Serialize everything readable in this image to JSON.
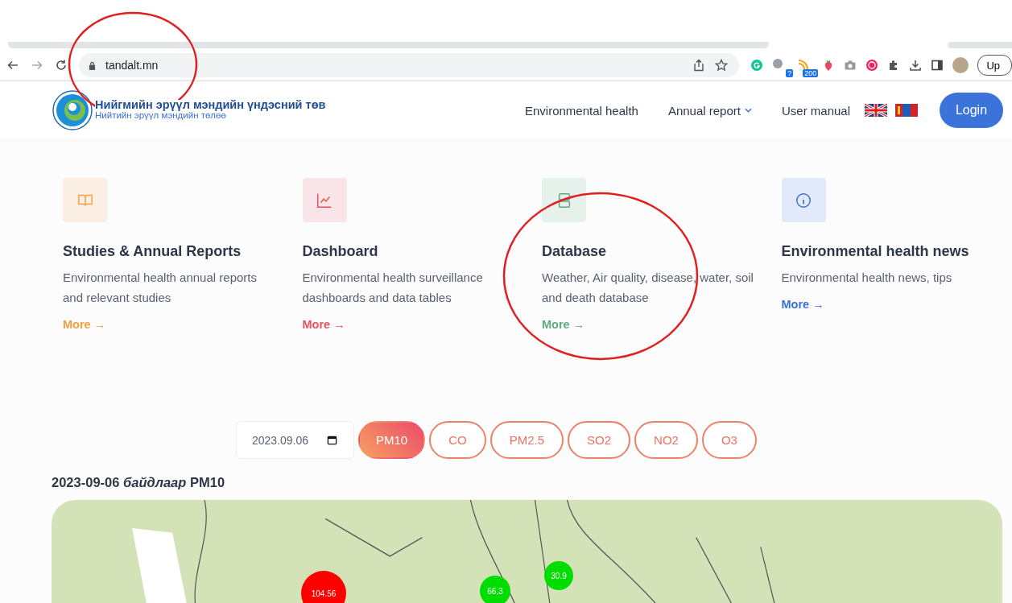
{
  "browser": {
    "url": "tandalt.mn",
    "extension_badges": [
      "?",
      "200"
    ],
    "profile_button": "Up"
  },
  "header": {
    "logo_title": "Нийгмийн эрүүл мэндийн үндэсний төв",
    "logo_subtitle": "Нийтийн эрүүл мэндийн төлөө",
    "nav": [
      {
        "label": "Environmental health",
        "dropdown": false
      },
      {
        "label": "Annual report",
        "dropdown": true
      },
      {
        "label": "User manual",
        "dropdown": false
      }
    ],
    "login": "Login"
  },
  "cards": [
    {
      "title": "Studies & Annual Reports",
      "description": "Environmental health annual reports and relevant studies",
      "link": "More →",
      "color": "#f5a040"
    },
    {
      "title": "Dashboard",
      "description": "Environmental health surveillance dashboards and data tables",
      "link": "More →",
      "color": "#e8505b"
    },
    {
      "title": "Database",
      "description": "Weather, Air quality, disease, water, soil and death database",
      "link": "More →",
      "color": "#5faa7f"
    },
    {
      "title": "Environmental health news",
      "description": "Environmental health news, tips",
      "link": "More →",
      "color": "#3a6fd8"
    }
  ],
  "filters": {
    "date": "2023.09.06",
    "pollutants": [
      {
        "label": "PM10",
        "selected": true
      },
      {
        "label": "CO",
        "selected": false
      },
      {
        "label": "PM2.5",
        "selected": false
      },
      {
        "label": "SO2",
        "selected": false
      },
      {
        "label": "NO2",
        "selected": false
      },
      {
        "label": "O3",
        "selected": false
      }
    ]
  },
  "map_heading": "2023-09-06 *байдлаар* PM10",
  "map_markers": [
    {
      "value": "104.56",
      "color": "#ff0000"
    },
    {
      "value": "66.3",
      "color": "#00dd00"
    },
    {
      "value": "30.9",
      "color": "#00dd00"
    }
  ]
}
